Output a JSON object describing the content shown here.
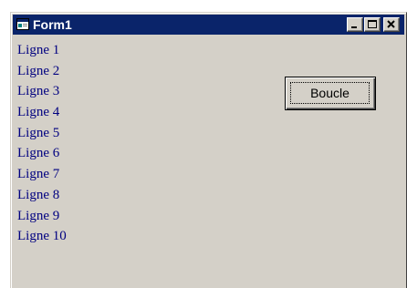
{
  "window": {
    "title": "Form1",
    "icon": "form-icon",
    "controls": {
      "minimize_icon": "minimize-icon",
      "maximize_icon": "maximize-icon",
      "close_icon": "close-icon"
    }
  },
  "lines": [
    "Ligne 1",
    "Ligne 2",
    "Ligne 3",
    "Ligne 4",
    "Ligne 5",
    "Ligne 6",
    "Ligne 7",
    "Ligne 8",
    "Ligne 9",
    "Ligne 10"
  ],
  "button": {
    "label": "Boucle"
  },
  "colors": {
    "titlebar": "#0a246a",
    "face": "#d4d0c8",
    "text": "#000080"
  }
}
